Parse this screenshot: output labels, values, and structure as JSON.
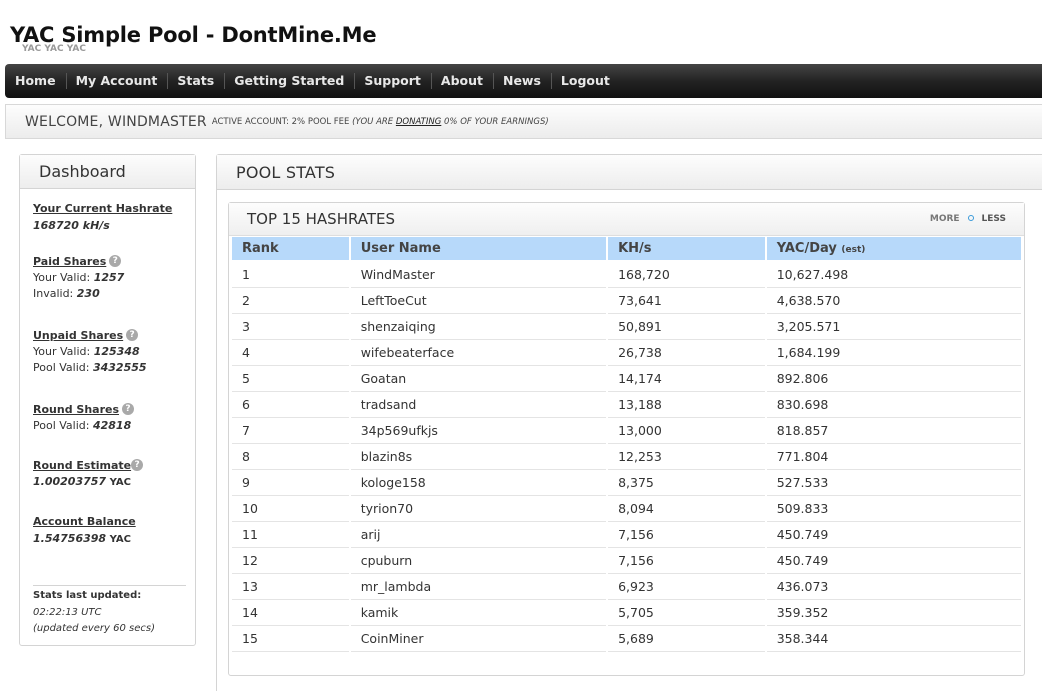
{
  "header": {
    "title": "YAC Simple Pool - DontMine.Me",
    "subtitle": "YAC YAC YAC"
  },
  "nav": {
    "items": [
      "Home",
      "My Account",
      "Stats",
      "Getting Started",
      "Support",
      "About",
      "News",
      "Logout"
    ]
  },
  "welcome": {
    "greeting": "WELCOME, WINDMASTER",
    "account_info": "ACTIVE ACCOUNT: 2% POOL FEE",
    "donate_prefix": "(YOU ARE ",
    "donate_link": "DONATING",
    "donate_suffix": " 0% OF YOUR EARNINGS)"
  },
  "sidebar": {
    "title": "Dashboard",
    "hashrate_title": "Your Current Hashrate",
    "hashrate_value": "168720 kH/s",
    "paid_title": "Paid Shares",
    "paid_valid_label": "Your Valid:",
    "paid_valid_value": "1257",
    "paid_invalid_label": "Invalid:",
    "paid_invalid_value": "230",
    "unpaid_title": "Unpaid Shares",
    "unpaid_your_label": "Your Valid:",
    "unpaid_your_value": "125348",
    "unpaid_pool_label": "Pool Valid:",
    "unpaid_pool_value": "3432555",
    "round_title": "Round Shares",
    "round_pool_label": "Pool Valid:",
    "round_pool_value": "42818",
    "estimate_title": "Round Estimate",
    "estimate_value": "1.00203757",
    "estimate_unit": "YAC",
    "balance_title": "Account Balance",
    "balance_value": "1.54756398",
    "balance_unit": "YAC",
    "stats_updated_label": "Stats last updated:",
    "stats_updated_time": "02:22:13 UTC",
    "stats_updated_note": "(updated every 60 secs)",
    "help_glyph": "?"
  },
  "main": {
    "title": "POOL STATS",
    "panel_title": "TOP 15 HASHRATES",
    "toggle_more": "MORE",
    "toggle_less": "LESS",
    "columns": {
      "rank": "Rank",
      "user": "User Name",
      "khs": "KH/s",
      "yac": "YAC/Day",
      "yac_note": "(est)"
    },
    "rows": [
      {
        "rank": "1",
        "user": "WindMaster",
        "khs": "168,720",
        "yac": "10,627.498"
      },
      {
        "rank": "2",
        "user": "LeftToeCut",
        "khs": "73,641",
        "yac": "4,638.570"
      },
      {
        "rank": "3",
        "user": "shenzaiqing",
        "khs": "50,891",
        "yac": "3,205.571"
      },
      {
        "rank": "4",
        "user": "wifebeaterface",
        "khs": "26,738",
        "yac": "1,684.199"
      },
      {
        "rank": "5",
        "user": "Goatan",
        "khs": "14,174",
        "yac": "892.806"
      },
      {
        "rank": "6",
        "user": "tradsand",
        "khs": "13,188",
        "yac": "830.698"
      },
      {
        "rank": "7",
        "user": "34p569ufkjs",
        "khs": "13,000",
        "yac": "818.857"
      },
      {
        "rank": "8",
        "user": "blazin8s",
        "khs": "12,253",
        "yac": "771.804"
      },
      {
        "rank": "9",
        "user": "kologe158",
        "khs": "8,375",
        "yac": "527.533"
      },
      {
        "rank": "10",
        "user": "tyrion70",
        "khs": "8,094",
        "yac": "509.833"
      },
      {
        "rank": "11",
        "user": "arij",
        "khs": "7,156",
        "yac": "450.749"
      },
      {
        "rank": "12",
        "user": "cpuburn",
        "khs": "7,156",
        "yac": "450.749"
      },
      {
        "rank": "13",
        "user": "mr_lambda",
        "khs": "6,923",
        "yac": "436.073"
      },
      {
        "rank": "14",
        "user": "kamik",
        "khs": "5,705",
        "yac": "359.352"
      },
      {
        "rank": "15",
        "user": "CoinMiner",
        "khs": "5,689",
        "yac": "358.344"
      }
    ]
  }
}
